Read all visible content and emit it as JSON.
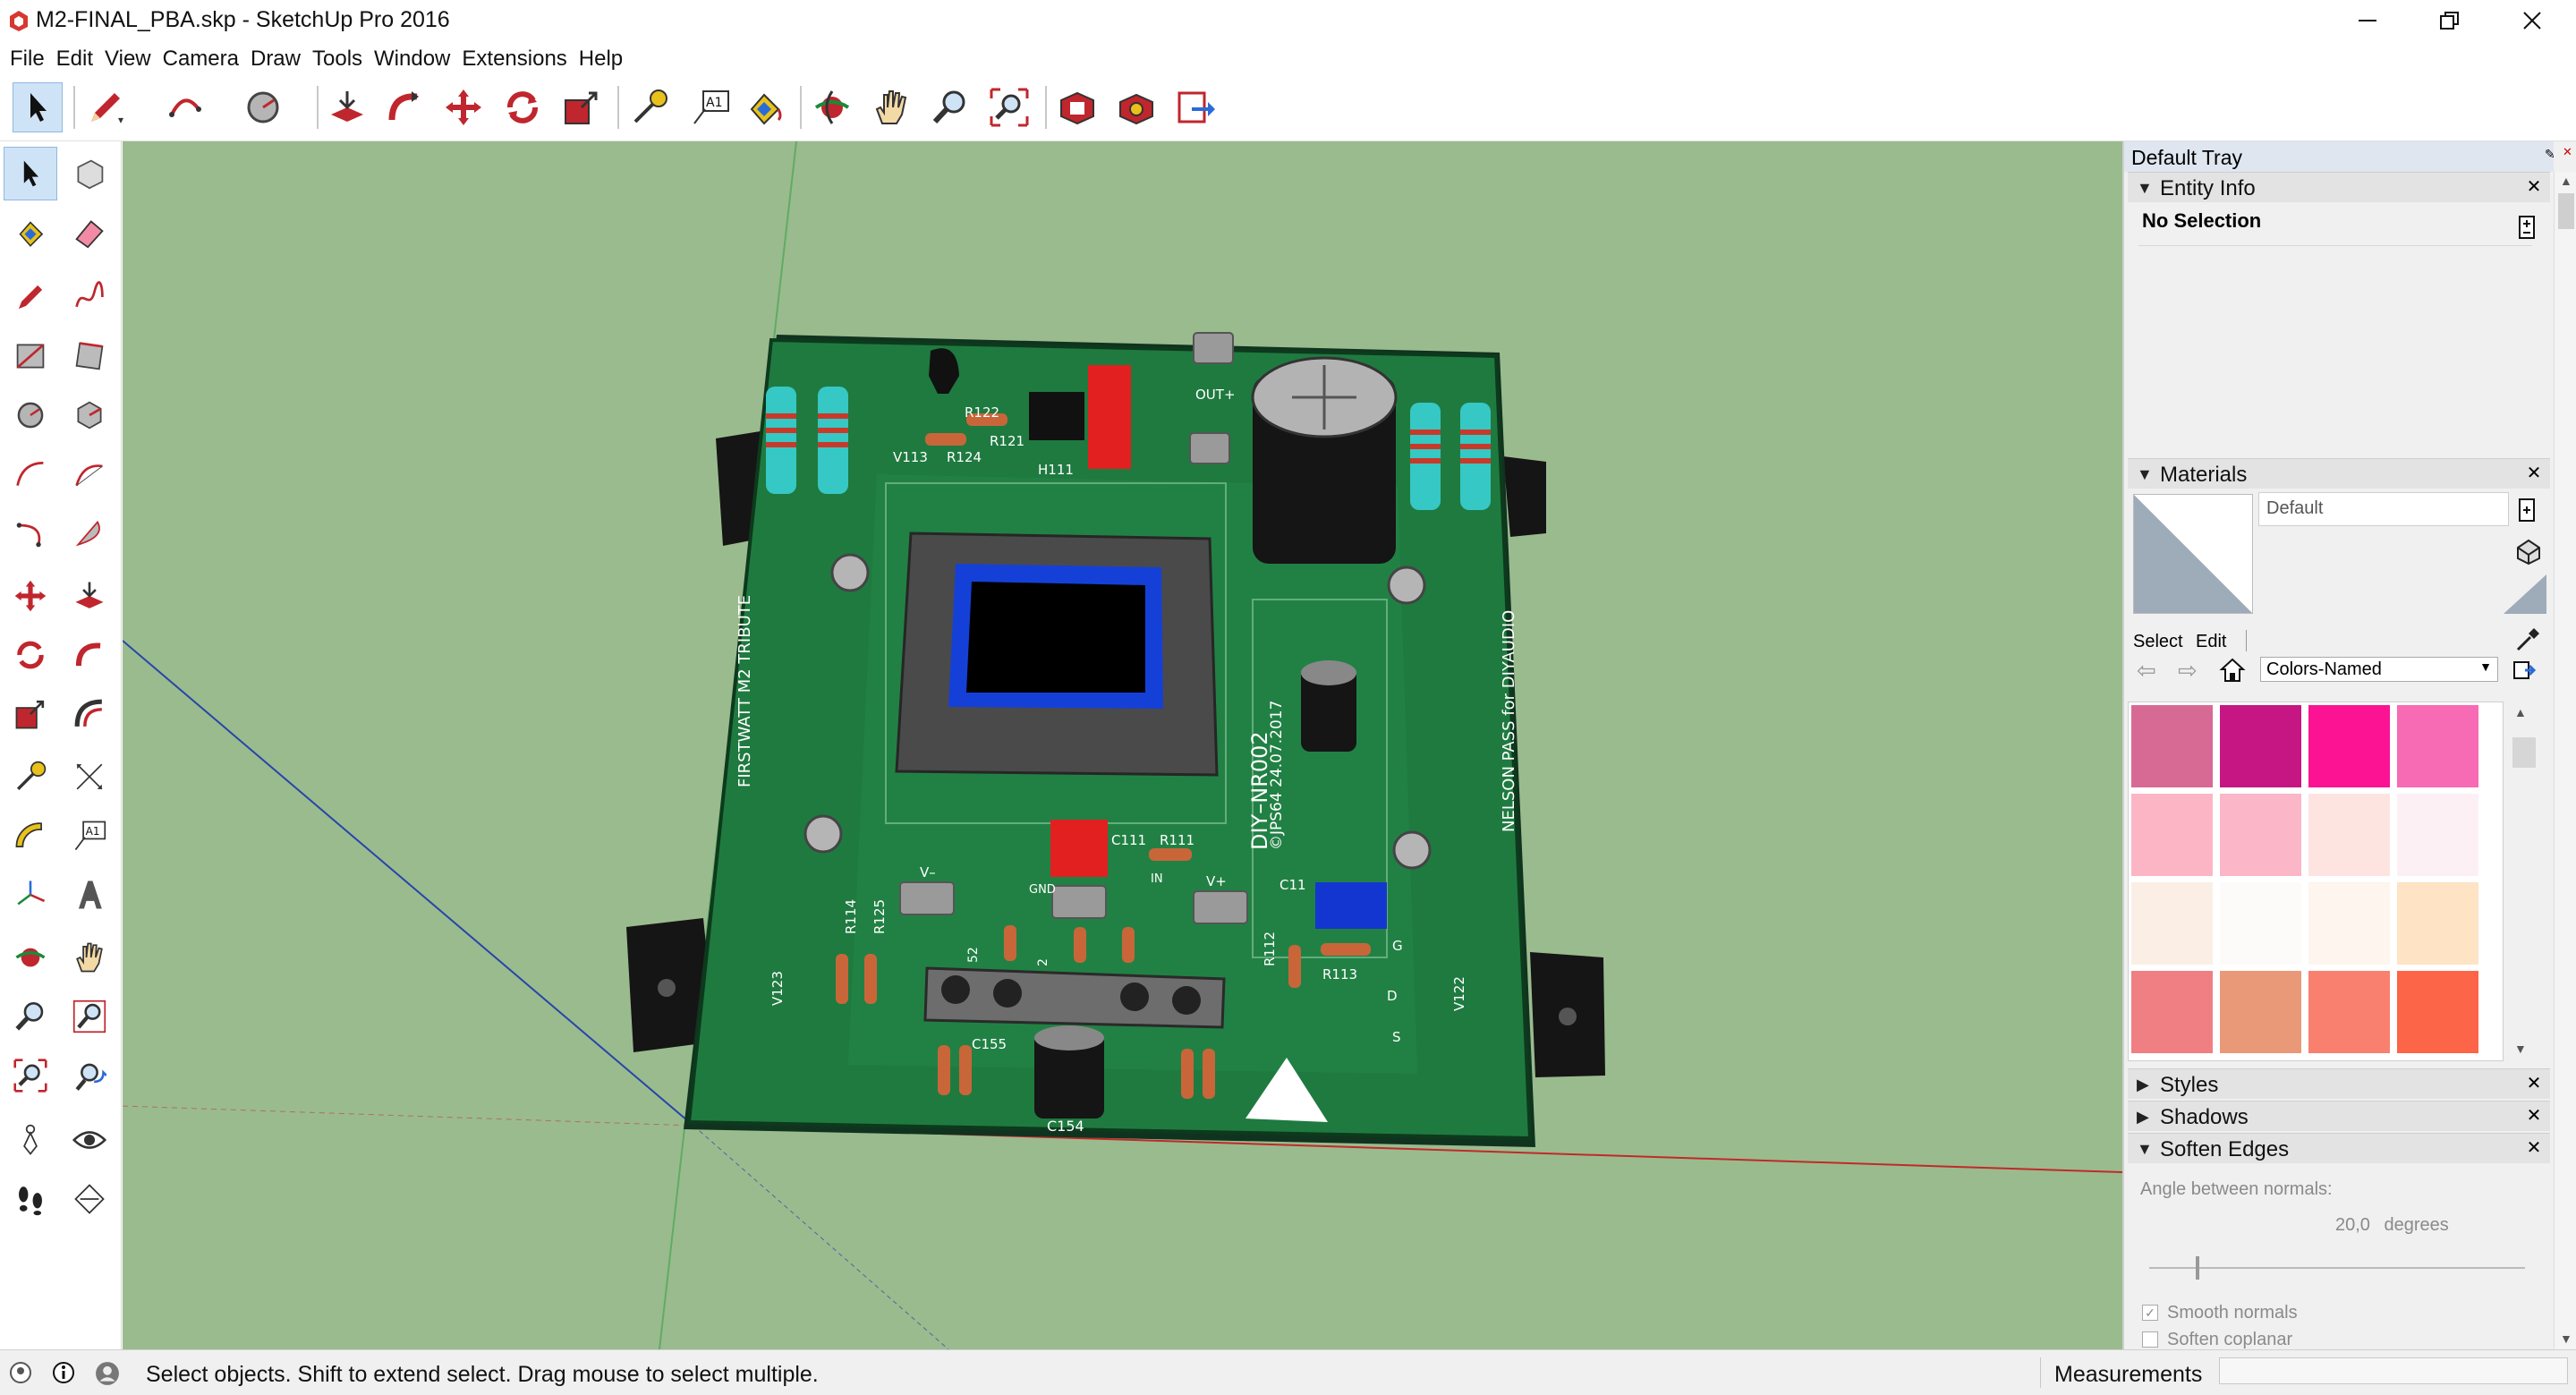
{
  "window": {
    "title": "M2-FINAL_PBA.skp - SketchUp Pro 2016",
    "minimize_icon": "minimize-icon",
    "maximize_icon": "restore-icon",
    "close_icon": "close-icon"
  },
  "menu": [
    "File",
    "Edit",
    "View",
    "Camera",
    "Draw",
    "Tools",
    "Window",
    "Extensions",
    "Help"
  ],
  "top_toolbar": [
    "select",
    "line",
    "arc",
    "circle",
    "push-pull",
    "follow-me",
    "move",
    "rotate",
    "scale",
    "tape-measure",
    "text",
    "paint-bucket",
    "orbit",
    "pan",
    "zoom",
    "zoom-extents",
    "3d-warehouse",
    "extension-warehouse",
    "send-to-layout"
  ],
  "left_toolbar": [
    "select",
    "make-component",
    "paint-bucket",
    "eraser",
    "line",
    "freehand",
    "rectangle",
    "rotated-rectangle",
    "circle",
    "polygon",
    "arc",
    "2-point-arc",
    "3-point-arc",
    "pie",
    "move",
    "push-pull",
    "rotate",
    "follow-me",
    "scale",
    "offset",
    "tape-measure",
    "dimension",
    "protractor",
    "text",
    "axes",
    "3d-text",
    "orbit",
    "pan",
    "zoom",
    "zoom-window",
    "zoom-extents",
    "previous",
    "position-camera",
    "look-around",
    "walk",
    "section-plane"
  ],
  "pcb": {
    "labels": {
      "out_plus": "OUT+",
      "r122": "R122",
      "r121": "R121",
      "v113": "V113",
      "r124": "R124",
      "h111": "H111",
      "left_tribute": "FIRSTWATT M2 TRIBUTE",
      "right_tribute": "NELSON PASS for DIYAUDIO",
      "diy_id": "DIY–NR002",
      "author_date": "©JPS64 24.07.2017",
      "c111": "C111",
      "r111": "R111",
      "c11": "C11",
      "v_minus": "V–",
      "gnd": "GND",
      "v_plus": "V+",
      "in": "IN",
      "r114": "R114",
      "r125": "R125",
      "v123": "V123",
      "r112": "R112",
      "r113": "R113",
      "v122": "V122",
      "c155": "C155",
      "c154": "C154",
      "d": "D",
      "g": "G",
      "s": "S",
      "r52": "52",
      "r2": "2"
    }
  },
  "tray": {
    "title": "Default Tray",
    "entity_info": {
      "label": "Entity Info",
      "value": "No Selection"
    },
    "materials": {
      "label": "Materials",
      "current": "Default",
      "tab_select": "Select",
      "tab_edit": "Edit",
      "library": "Colors-Named",
      "swatches": [
        "#d76a94",
        "#c51683",
        "#fb1393",
        "#f76bb4",
        "#fcb5c5",
        "#fbb6c8",
        "#fde4e1",
        "#fdf0f4",
        "#fbefe5",
        "#fdfbfa",
        "#fdf5ee",
        "#fee3c5",
        "#ef7f83",
        "#e99978",
        "#f9806f",
        "#fd6548"
      ]
    },
    "styles": "Styles",
    "shadows": "Shadows",
    "soften_edges": {
      "label": "Soften Edges",
      "angle_label": "Angle between normals:",
      "angle_value": "20,0",
      "angle_unit": "degrees",
      "smooth_normals": "Smooth normals",
      "soften_coplanar": "Soften coplanar"
    }
  },
  "status": {
    "hint": "Select objects. Shift to extend select. Drag mouse to select multiple.",
    "measurements_label": "Measurements"
  }
}
